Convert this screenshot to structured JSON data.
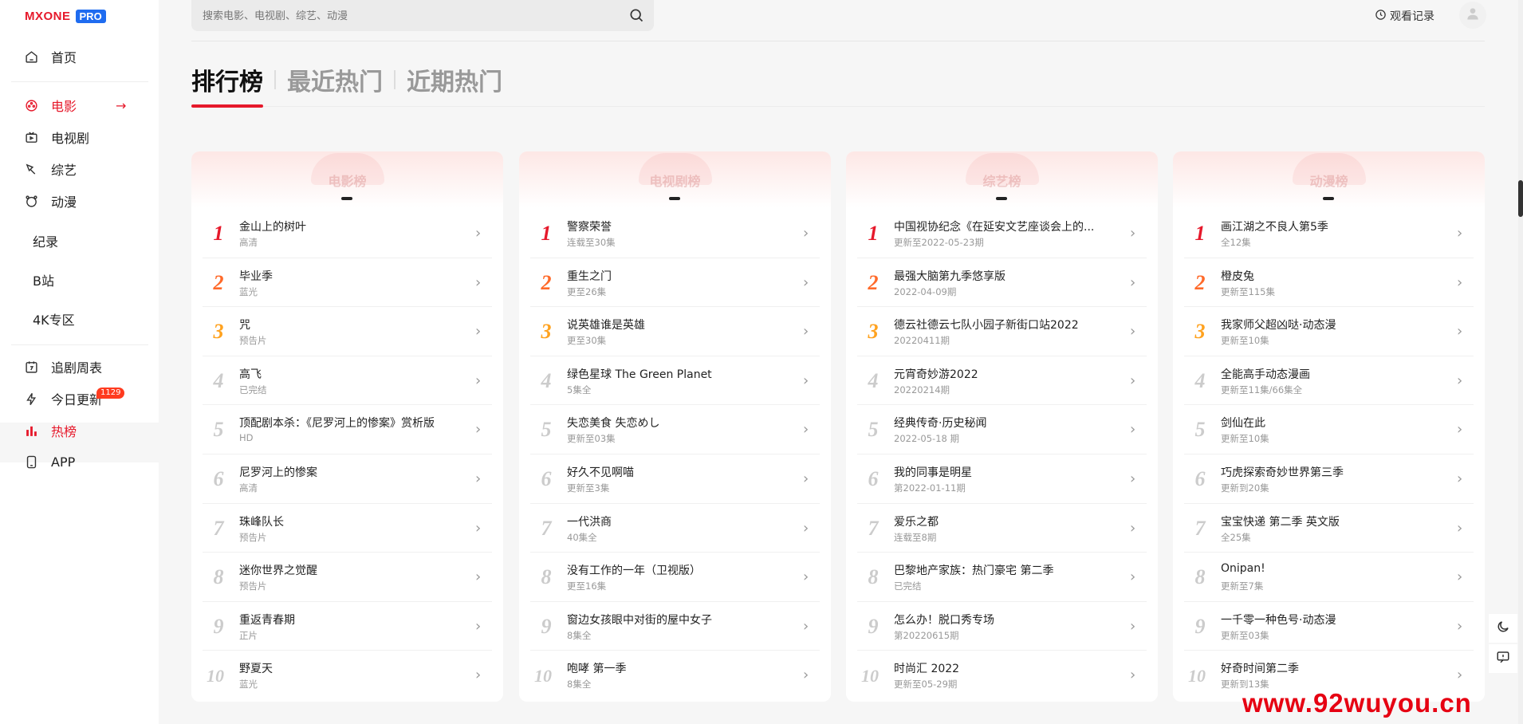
{
  "logo": {
    "text": "MXONE",
    "badge": "PRO"
  },
  "nav": {
    "home": "首页",
    "movie": "电影",
    "tv": "电视剧",
    "variety": "综艺",
    "anime": "动漫",
    "doc": "纪录",
    "bili": "B站",
    "k4": "4K专区",
    "schedule": "追剧周表",
    "today": "今日更新",
    "today_badge": "1129",
    "hot": "热榜",
    "app": "APP"
  },
  "search": {
    "placeholder": "搜索电影、电视剧、综艺、动漫"
  },
  "header": {
    "history": "观看记录"
  },
  "tabs": [
    "排行榜",
    "最近热门",
    "近期热门"
  ],
  "watermark": "www.92wuyou.cn",
  "colors": {
    "accent": "#e6192b",
    "rank2": "#ff6a2a",
    "rank3": "#ffa21f",
    "pro": "#1f6cf0"
  },
  "cards": [
    {
      "title": "电影榜",
      "items": [
        {
          "rank": "1",
          "title": "金山上的树叶",
          "sub": "高清"
        },
        {
          "rank": "2",
          "title": "毕业季",
          "sub": "蓝光"
        },
        {
          "rank": "3",
          "title": "咒",
          "sub": "预告片"
        },
        {
          "rank": "4",
          "title": "高飞",
          "sub": "已完结"
        },
        {
          "rank": "5",
          "title": "顶配剧本杀：《尼罗河上的惨案》赏析版",
          "sub": "HD"
        },
        {
          "rank": "6",
          "title": "尼罗河上的惨案",
          "sub": "高清"
        },
        {
          "rank": "7",
          "title": "珠峰队长",
          "sub": "预告片"
        },
        {
          "rank": "8",
          "title": "迷你世界之觉醒",
          "sub": "预告片"
        },
        {
          "rank": "9",
          "title": "重返青春期",
          "sub": "正片"
        },
        {
          "rank": "10",
          "title": "野夏天",
          "sub": "蓝光"
        }
      ]
    },
    {
      "title": "电视剧榜",
      "items": [
        {
          "rank": "1",
          "title": "警察荣誉",
          "sub": "连载至30集"
        },
        {
          "rank": "2",
          "title": "重生之门",
          "sub": "更至26集"
        },
        {
          "rank": "3",
          "title": "说英雄谁是英雄",
          "sub": "更至30集"
        },
        {
          "rank": "4",
          "title": "绿色星球 The Green Planet",
          "sub": "5集全"
        },
        {
          "rank": "5",
          "title": "失恋美食 失恋めし",
          "sub": "更新至03集"
        },
        {
          "rank": "6",
          "title": "好久不见啊喵",
          "sub": "更新至3集"
        },
        {
          "rank": "7",
          "title": "一代洪商",
          "sub": "40集全"
        },
        {
          "rank": "8",
          "title": "没有工作的一年（卫视版）",
          "sub": "更至16集"
        },
        {
          "rank": "9",
          "title": "窗边女孩眼中对街的屋中女子",
          "sub": "8集全"
        },
        {
          "rank": "10",
          "title": "咆哮 第一季",
          "sub": "8集全"
        }
      ]
    },
    {
      "title": "综艺榜",
      "items": [
        {
          "rank": "1",
          "title": "中国视协纪念《在延安文艺座谈会上的...",
          "sub": "更新至2022-05-23期"
        },
        {
          "rank": "2",
          "title": "最强大脑第九季悠享版",
          "sub": "2022-04-09期"
        },
        {
          "rank": "3",
          "title": "德云社德云七队小园子新街口站2022",
          "sub": "20220411期"
        },
        {
          "rank": "4",
          "title": "元宵奇妙游2022",
          "sub": "20220214期"
        },
        {
          "rank": "5",
          "title": "经典传奇·历史秘闻",
          "sub": "2022-05-18 期"
        },
        {
          "rank": "6",
          "title": "我的同事是明星",
          "sub": "第2022-01-11期"
        },
        {
          "rank": "7",
          "title": "爱乐之都",
          "sub": "连载至8期"
        },
        {
          "rank": "8",
          "title": "巴黎地产家族：热门豪宅 第二季",
          "sub": "已完结"
        },
        {
          "rank": "9",
          "title": "怎么办！脱口秀专场",
          "sub": "第20220615期"
        },
        {
          "rank": "10",
          "title": "时尚汇 2022",
          "sub": "更新至05-29期"
        }
      ]
    },
    {
      "title": "动漫榜",
      "items": [
        {
          "rank": "1",
          "title": "画江湖之不良人第5季",
          "sub": "全12集"
        },
        {
          "rank": "2",
          "title": "橙皮兔",
          "sub": "更新至115集"
        },
        {
          "rank": "3",
          "title": "我家师父超凶哒·动态漫",
          "sub": "更新至10集"
        },
        {
          "rank": "4",
          "title": "全能高手动态漫画",
          "sub": "更新至11集/66集全"
        },
        {
          "rank": "5",
          "title": "剑仙在此",
          "sub": "更新至10集"
        },
        {
          "rank": "6",
          "title": "巧虎探索奇妙世界第三季",
          "sub": "更新到20集"
        },
        {
          "rank": "7",
          "title": "宝宝快递 第二季 英文版",
          "sub": "全25集"
        },
        {
          "rank": "8",
          "title": "Onipan!",
          "sub": "更新至7集"
        },
        {
          "rank": "9",
          "title": "一千零一种色号·动态漫",
          "sub": "更新至03集"
        },
        {
          "rank": "10",
          "title": "好奇时间第二季",
          "sub": "更新到13集"
        }
      ]
    }
  ]
}
